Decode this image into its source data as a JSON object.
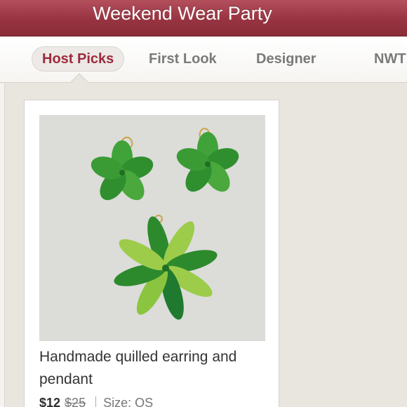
{
  "header": {
    "title": "Weekend Wear Party"
  },
  "tabs": [
    {
      "label": "Host Picks",
      "active": true
    },
    {
      "label": "First Look",
      "active": false
    },
    {
      "label": "Designer",
      "active": false
    },
    {
      "label": "NWT",
      "active": false
    }
  ],
  "listing": {
    "title": "Handmade quilled earring and pendant",
    "price": "$12",
    "original_price": "$25",
    "size": "Size: OS",
    "photo_icon": "quilled-flower-jewelry-photo"
  },
  "colors": {
    "header": "#983441",
    "active_tab_text": "#9c2b3b",
    "background": "#e9e6df",
    "dark_green": "#1f7a2f",
    "light_green": "#8bc53f"
  }
}
